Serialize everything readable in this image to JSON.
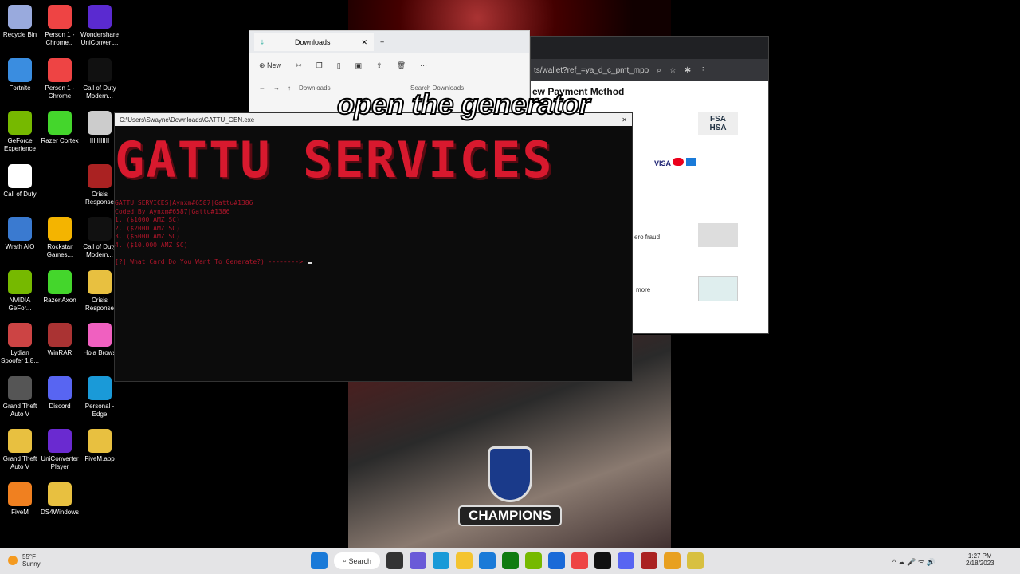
{
  "desktop_icons": [
    {
      "label": "Recycle Bin",
      "color": "#9ad"
    },
    {
      "label": "Fortnite",
      "color": "#3a8de0"
    },
    {
      "label": "GeForce Experience",
      "color": "#76b900"
    },
    {
      "label": "Call of Duty",
      "color": "#fff"
    },
    {
      "label": "Wrath AIO",
      "color": "#3a7ad0"
    },
    {
      "label": "NVIDIA GeFor...",
      "color": "#76b900"
    },
    {
      "label": "Lydian Spoofer 1.8...",
      "color": "#c44"
    },
    {
      "label": "Grand Theft Auto V",
      "color": "#555"
    },
    {
      "label": "Grand Theft Auto V",
      "color": "#e8c040"
    },
    {
      "label": "FiveM",
      "color": "#f08020"
    },
    {
      "label": "Person 1 - Chrome...",
      "color": "#e44"
    },
    {
      "label": "Person 1 - Chrome",
      "color": "#e44"
    },
    {
      "label": "Razer Cortex",
      "color": "#44d62c"
    },
    {
      "label": "",
      "color": "transparent"
    },
    {
      "label": "Rockstar Games...",
      "color": "#f4b400"
    },
    {
      "label": "Razer Axon",
      "color": "#44d62c"
    },
    {
      "label": "WinRAR",
      "color": "#a33"
    },
    {
      "label": "Discord",
      "color": "#5865f2"
    },
    {
      "label": "UniConverter Player",
      "color": "#6a2ad0"
    },
    {
      "label": "DS4Windows",
      "color": "#e8c040"
    },
    {
      "label": "Wondershare UniConvert...",
      "color": "#5a2ad0"
    },
    {
      "label": "Call of Duty Modern...",
      "color": "#111"
    },
    {
      "label": "IIIIIIIIIII",
      "color": "#ccc"
    },
    {
      "label": "Crisis Response",
      "color": "#a22"
    },
    {
      "label": "Call of Duty Modern...",
      "color": "#111"
    },
    {
      "label": "Crisis Response",
      "color": "#e8c040"
    },
    {
      "label": "Hola Brows",
      "color": "#f060c0"
    },
    {
      "label": "Personal - Edge",
      "color": "#1a9ad8"
    },
    {
      "label": "FiveM.app",
      "color": "#e8c040"
    }
  ],
  "explorer": {
    "tab": "Downloads",
    "new_label": "New",
    "breadcrumb": "Downloads",
    "search_placeholder": "Search Downloads"
  },
  "browser": {
    "url": "ts/wallet?ref_=ya_d_c_pmt_mpo",
    "heading": "ew Payment Method",
    "fsa": "FSA HSA",
    "card_brands": "VISA",
    "fraud_text": "ero fraud",
    "more_text": "more"
  },
  "console": {
    "title": "C:\\Users\\Swayne\\Downloads\\GATTU_GEN.exe",
    "banner": "GATTU SERVICES",
    "lines": [
      "GATTU SERVICES|Aynxm#6587|Gattu#1386",
      "Coded By Aynxm#6587|Gattu#1386",
      "1. ($1000 AMZ SC)",
      "2. ($2000 AMZ SC)",
      "3. ($5000 AMZ SC)",
      "4. ($10.000 AMZ SC)"
    ],
    "prompt": "[?] What Card Do You Want To Generate?) -------->"
  },
  "caption": "open the generator",
  "nfl": "CHAMPIONS",
  "taskbar": {
    "weather_temp": "55°F",
    "weather_cond": "Sunny",
    "search": "Search",
    "time": "1:27 PM",
    "date": "2/18/2023",
    "apps": [
      {
        "name": "start",
        "color": "#1a7ad8"
      },
      {
        "name": "task-view",
        "color": "#333"
      },
      {
        "name": "chat",
        "color": "#6a5ad8"
      },
      {
        "name": "edge",
        "color": "#1a9ad8"
      },
      {
        "name": "file-explorer",
        "color": "#f4c430"
      },
      {
        "name": "mail",
        "color": "#1a7ad8"
      },
      {
        "name": "xbox",
        "color": "#107c10"
      },
      {
        "name": "nvidia",
        "color": "#76b900"
      },
      {
        "name": "defender",
        "color": "#1a6ad8"
      },
      {
        "name": "chrome",
        "color": "#e44"
      },
      {
        "name": "call-of-duty",
        "color": "#111"
      },
      {
        "name": "discord",
        "color": "#5865f2"
      },
      {
        "name": "crisis-response",
        "color": "#a22"
      },
      {
        "name": "chrome-profile",
        "color": "#e8a020"
      },
      {
        "name": "gattu-gen",
        "color": "#d8c040"
      }
    ]
  }
}
